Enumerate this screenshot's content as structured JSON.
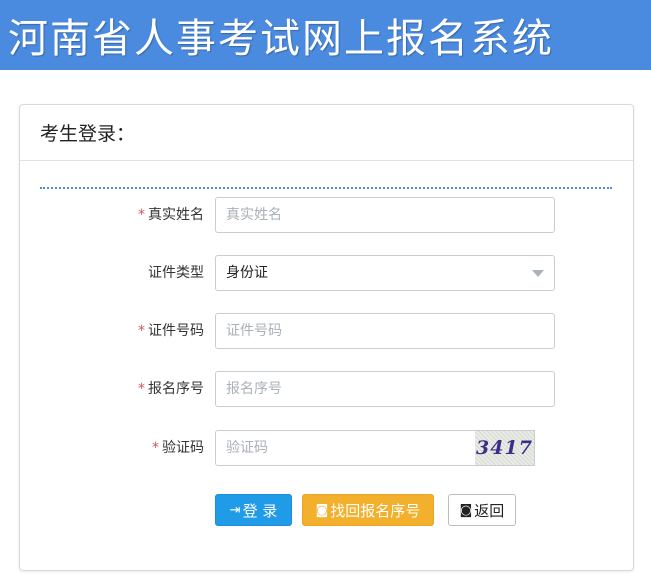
{
  "banner": {
    "title": "河南省人事考试网上报名系统"
  },
  "panel": {
    "header_title": "考生登录："
  },
  "form": {
    "required_mark": "*",
    "real_name": {
      "label": "真实姓名",
      "placeholder": "真实姓名",
      "required": true
    },
    "id_type": {
      "label": "证件类型",
      "selected": "身份证",
      "required": false
    },
    "id_number": {
      "label": "证件号码",
      "placeholder": "证件号码",
      "required": true
    },
    "reg_number": {
      "label": "报名序号",
      "placeholder": "报名序号",
      "required": true
    },
    "captcha": {
      "label": "验证码",
      "placeholder": "验证码",
      "image_text": "3417",
      "required": true
    }
  },
  "buttons": {
    "login": {
      "icon": "sign-in-icon",
      "label": "登 录"
    },
    "find": {
      "icon": "binoculars-icon",
      "label": "找回报名序号"
    },
    "back": {
      "icon": "binoculars-icon",
      "label": "返回"
    }
  },
  "colors": {
    "banner_bg": "#4a8adf",
    "login_btn": "#1f9be8",
    "find_btn": "#f3b02c",
    "required": "#d9534f"
  }
}
